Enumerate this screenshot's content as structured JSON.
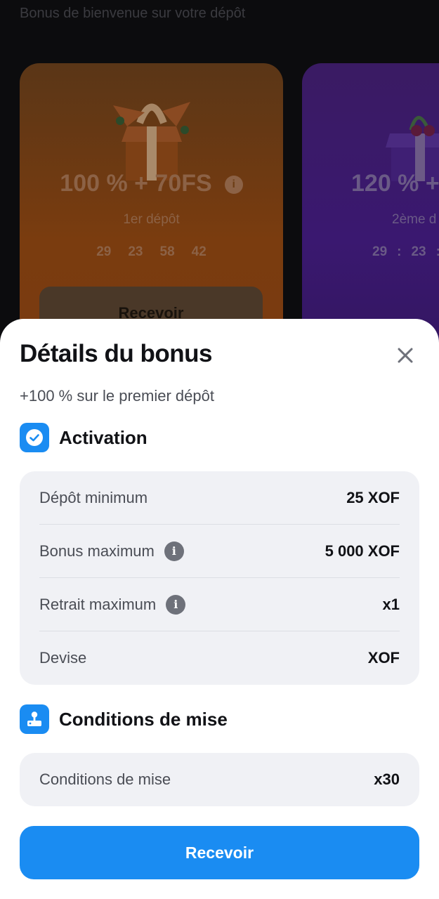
{
  "background": {
    "title": "Bonus de bienvenue sur votre dépôt",
    "cards": [
      {
        "offer": "100 % + 70FS",
        "subtitle": "1er dépôt",
        "timer": [
          "29",
          "23",
          "58",
          "42"
        ],
        "button_label": "Recevoir",
        "color": "#7a3c0f"
      },
      {
        "offer": "120 % +",
        "subtitle": "2ème d",
        "timer": [
          "29",
          ":",
          "23",
          ":"
        ],
        "color": "#3a1870"
      }
    ]
  },
  "sheet": {
    "title": "Détails du bonus",
    "subtitle": "+100 % sur le premier dépôt",
    "activation": {
      "title": "Activation",
      "rows": [
        {
          "label": "Dépôt minimum",
          "value": "25 XOF"
        },
        {
          "label": "Bonus maximum",
          "value": "5 000 XOF"
        },
        {
          "label": "Retrait maximum",
          "value": "x1"
        },
        {
          "label": "Devise",
          "value": "XOF"
        }
      ]
    },
    "wagering": {
      "title": "Conditions de mise",
      "rows": [
        {
          "label": "Conditions de mise",
          "value": "x30"
        }
      ]
    },
    "primary_button": "Recevoir",
    "accent_color": "#1a8cf2"
  }
}
